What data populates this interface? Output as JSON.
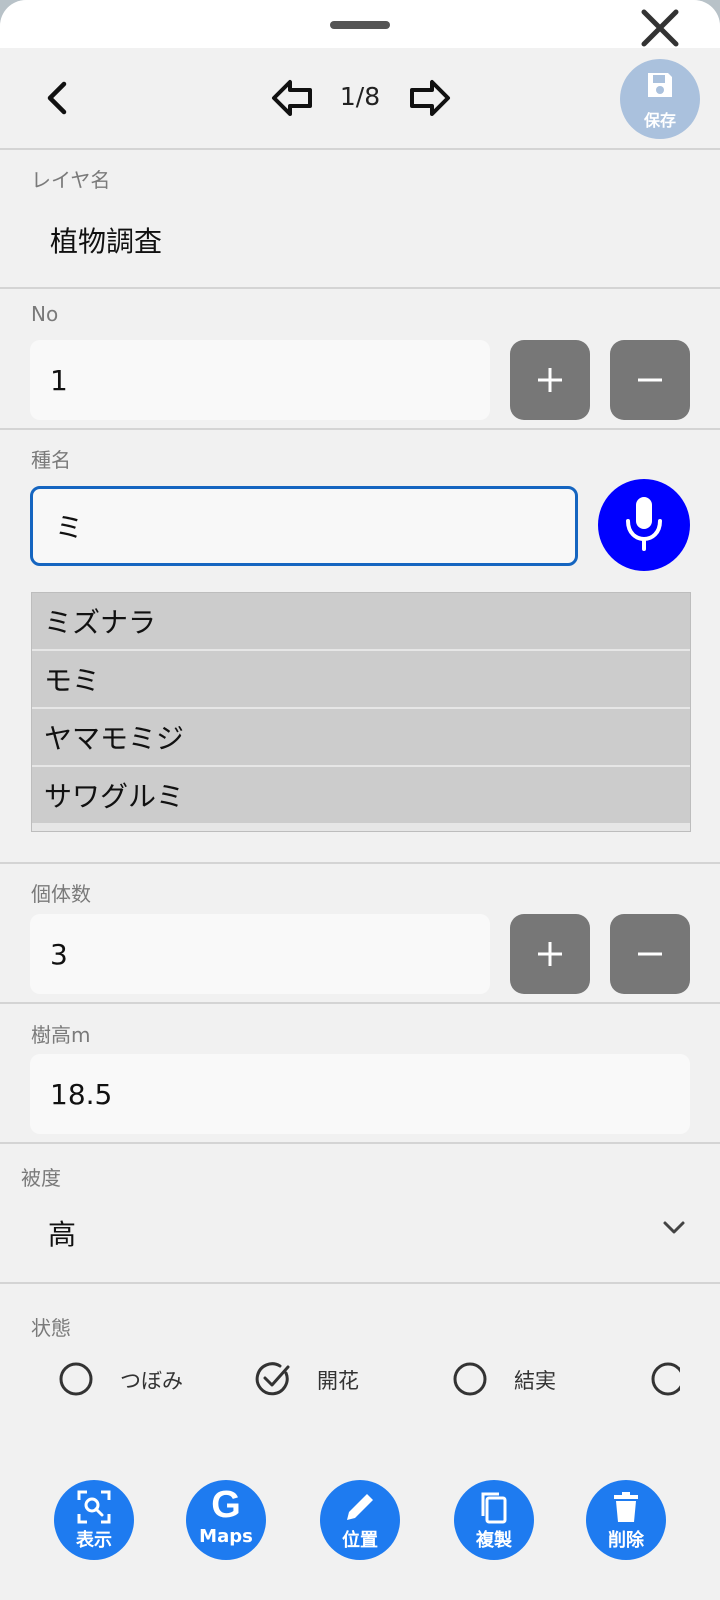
{
  "toolbar": {
    "page_indicator": "1/8",
    "save_label": "保存"
  },
  "fields": {
    "layer_name": {
      "label": "レイヤ名",
      "value": "植物調査"
    },
    "no": {
      "label": "No",
      "value": "1"
    },
    "species": {
      "label": "種名",
      "value": "ミ",
      "suggestions": [
        "ミズナラ",
        "モミ",
        "ヤマモミジ",
        "サワグルミ"
      ]
    },
    "count": {
      "label": "個体数",
      "value": "3"
    },
    "height": {
      "label": "樹高m",
      "value": "18.5"
    },
    "coverage": {
      "label": "被度",
      "value": "高"
    },
    "status": {
      "label": "状態",
      "options": [
        {
          "label": "つぼみ",
          "checked": false
        },
        {
          "label": "開花",
          "checked": true
        },
        {
          "label": "結実",
          "checked": false
        }
      ]
    }
  },
  "actions": {
    "show_label": "表示",
    "maps_label": "Maps",
    "maps_mark": "G",
    "position_label": "位置",
    "duplicate_label": "複製",
    "delete_label": "削除"
  },
  "colors": {
    "accent": "#1e7bf0",
    "mic": "#0000ff",
    "focus_border": "#1565c0",
    "stepper": "#777777",
    "save_disabled": "#aac1dd"
  }
}
